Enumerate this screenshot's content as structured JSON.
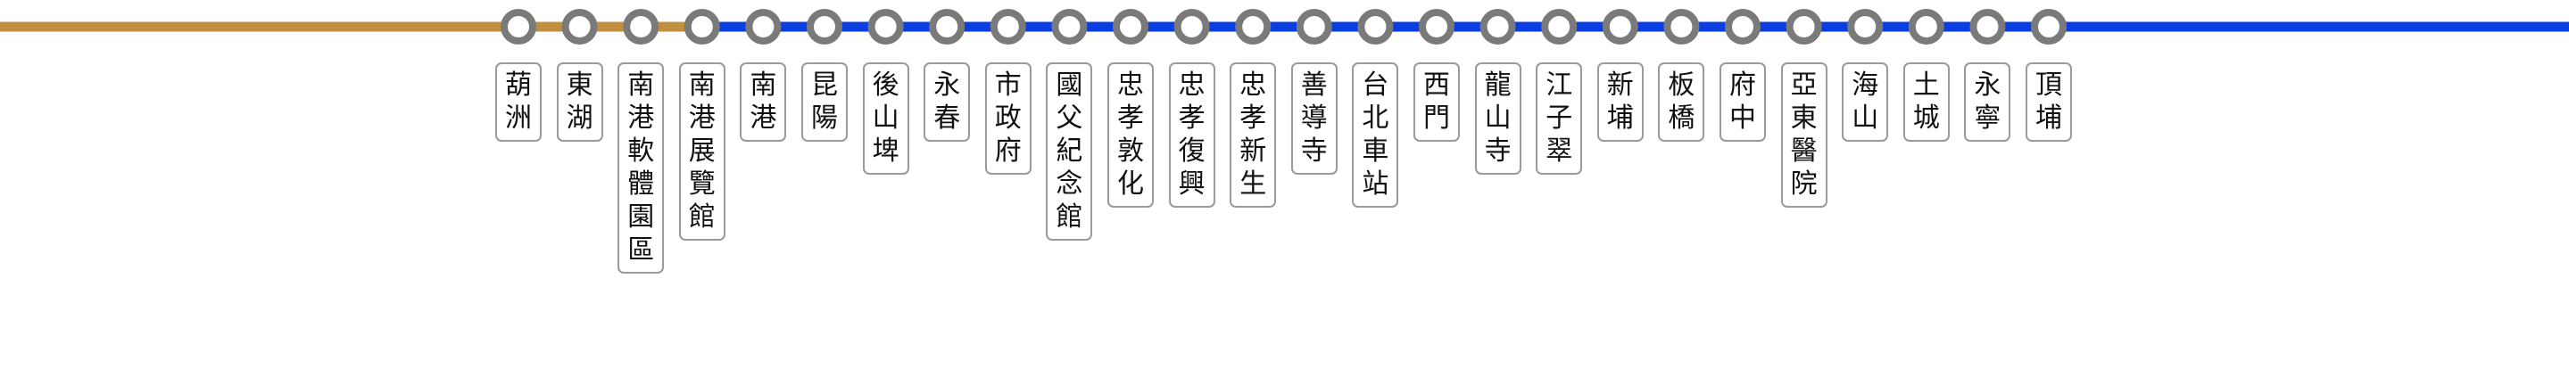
{
  "route": {
    "colors": {
      "shared_segment": "#c09040",
      "main_line": "#0a3ee0",
      "station_ring": "#7a7a7a",
      "station_fill": "#ffffff",
      "label_border": "#9a9a9a"
    },
    "shared_segment_station_count": 4,
    "stations": [
      {
        "name": "葫洲"
      },
      {
        "name": "東湖"
      },
      {
        "name": "南港軟體園區"
      },
      {
        "name": "南港展覽館"
      },
      {
        "name": "南港"
      },
      {
        "name": "昆陽"
      },
      {
        "name": "後山埤"
      },
      {
        "name": "永春"
      },
      {
        "name": "市政府"
      },
      {
        "name": "國父紀念館"
      },
      {
        "name": "忠孝敦化"
      },
      {
        "name": "忠孝復興"
      },
      {
        "name": "忠孝新生"
      },
      {
        "name": "善導寺"
      },
      {
        "name": "台北車站"
      },
      {
        "name": "西門"
      },
      {
        "name": "龍山寺"
      },
      {
        "name": "江子翠"
      },
      {
        "name": "新埔"
      },
      {
        "name": "板橋"
      },
      {
        "name": "府中"
      },
      {
        "name": "亞東醫院"
      },
      {
        "name": "海山"
      },
      {
        "name": "土城"
      },
      {
        "name": "永寧"
      },
      {
        "name": "頂埔"
      }
    ]
  }
}
